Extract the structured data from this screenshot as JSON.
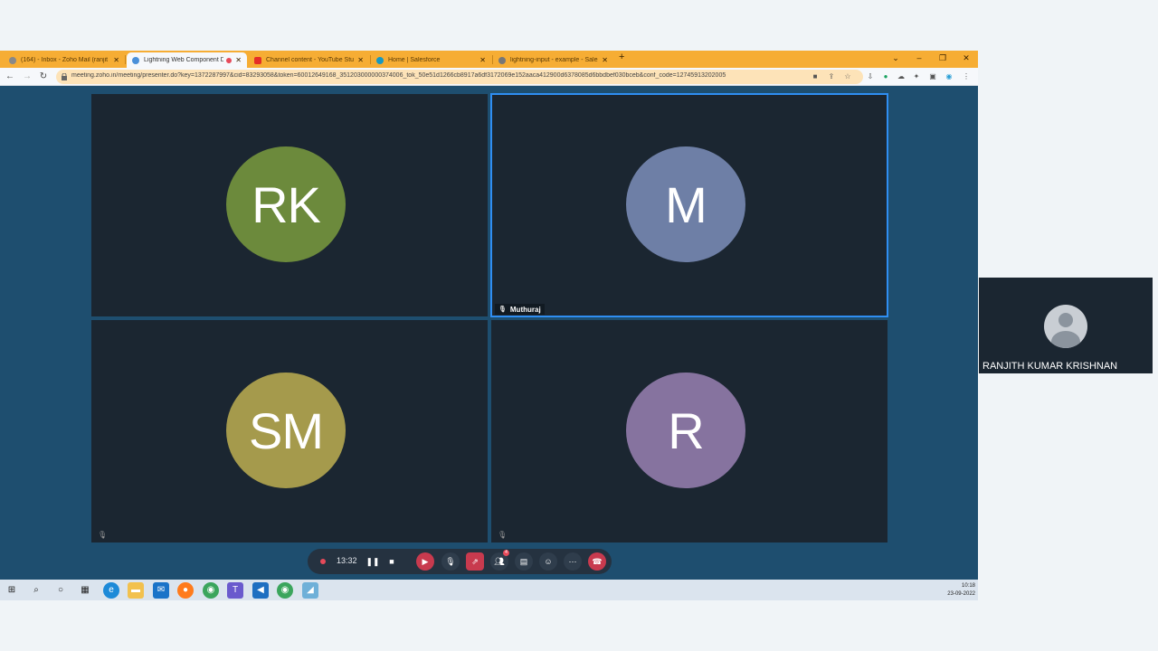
{
  "browser": {
    "tabs": [
      {
        "label": "(164) - Inbox - Zoho Mail (ranjit",
        "favicon_color": "#888888",
        "active": false
      },
      {
        "label": "Lightning Web Component D",
        "favicon_color": "#4a90d9",
        "active": true
      },
      {
        "label": "Channel content - YouTube Studi",
        "favicon_color": "#e52d27",
        "active": false
      },
      {
        "label": "Home | Salesforce",
        "favicon_color": "#1798c1",
        "active": false
      },
      {
        "label": "lightning-input - example - Sales",
        "favicon_color": "#777777",
        "active": false
      }
    ],
    "new_tab": "+",
    "url": "meeting.zoho.in/meeting/presenter.do?key=1372287997&cid=83293058&token=60012649168_351203000000374006_tok_50e51d1266cb8917a6df3172069e152aaca412900d6378085d6bbdbef030bceb&conf_code=1274591320200​5",
    "tab_bar_color": "#f6ad34"
  },
  "meeting": {
    "participants": [
      {
        "initials": "RK",
        "color": "#6c8a3c",
        "name": "",
        "muted": false
      },
      {
        "initials": "M",
        "color": "#6e7fa6",
        "name": "Muthuraj",
        "muted": false,
        "speaking": true
      },
      {
        "initials": "SM",
        "color": "#a59a4c",
        "name": "",
        "muted": true
      },
      {
        "initials": "R",
        "color": "#86739f",
        "name": "",
        "muted": true
      }
    ],
    "recording_time": "13:32",
    "participant_badge": "4"
  },
  "self_view": {
    "name": "RANJITH KUMAR KRISHNAN"
  },
  "taskbar": {
    "time": "10:18",
    "date": "23-09-2022"
  }
}
